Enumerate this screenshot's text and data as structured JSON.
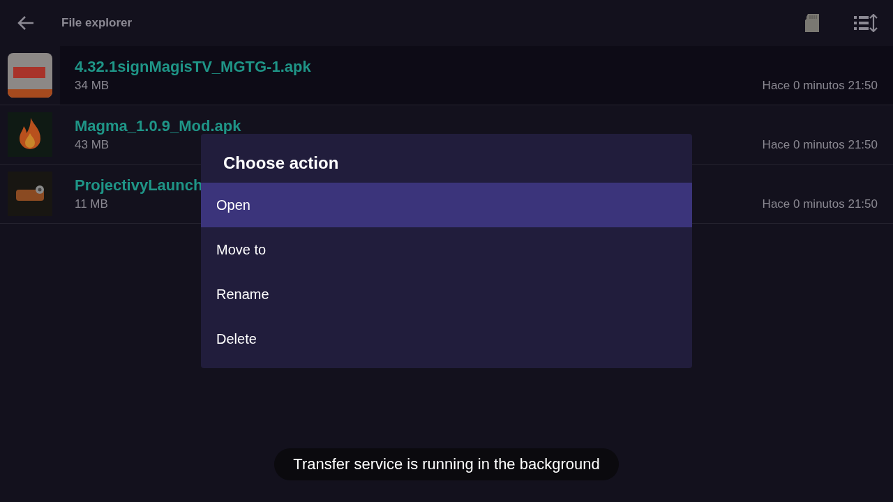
{
  "header": {
    "title": "File explorer"
  },
  "files": [
    {
      "name": "4.32.1signMagisTV_MGTG-1.apk",
      "size": "34 MB",
      "modified": "Hace 0 minutos 21:50"
    },
    {
      "name": "Magma_1.0.9_Mod.apk",
      "size": "43 MB",
      "modified": "Hace 0 minutos 21:50"
    },
    {
      "name": "ProjectivyLaunch",
      "size": "11 MB",
      "modified": "Hace 0 minutos 21:50"
    }
  ],
  "dialog": {
    "title": "Choose action",
    "actions": [
      {
        "label": "Open",
        "selected": true
      },
      {
        "label": "Move to",
        "selected": false
      },
      {
        "label": "Rename",
        "selected": false
      },
      {
        "label": "Delete",
        "selected": false
      }
    ]
  },
  "toast": "Transfer service is running in the background"
}
